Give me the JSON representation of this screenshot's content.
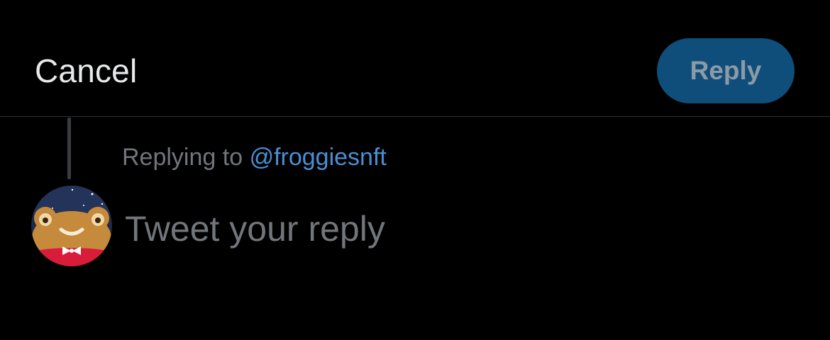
{
  "header": {
    "cancel_label": "Cancel",
    "reply_label": "Reply"
  },
  "replying": {
    "prefix": "Replying to",
    "handle": "@froggiesnft"
  },
  "composer": {
    "placeholder": "Tweet your reply",
    "value": ""
  },
  "avatar": {
    "icon": "frog-avatar-icon"
  },
  "colors": {
    "background": "#000000",
    "reply_button_bg": "#0f4e7a",
    "reply_button_text": "#8b9aa6",
    "link": "#4a8fd4",
    "muted_text": "#71767b",
    "primary_text": "#e7e9ea"
  }
}
